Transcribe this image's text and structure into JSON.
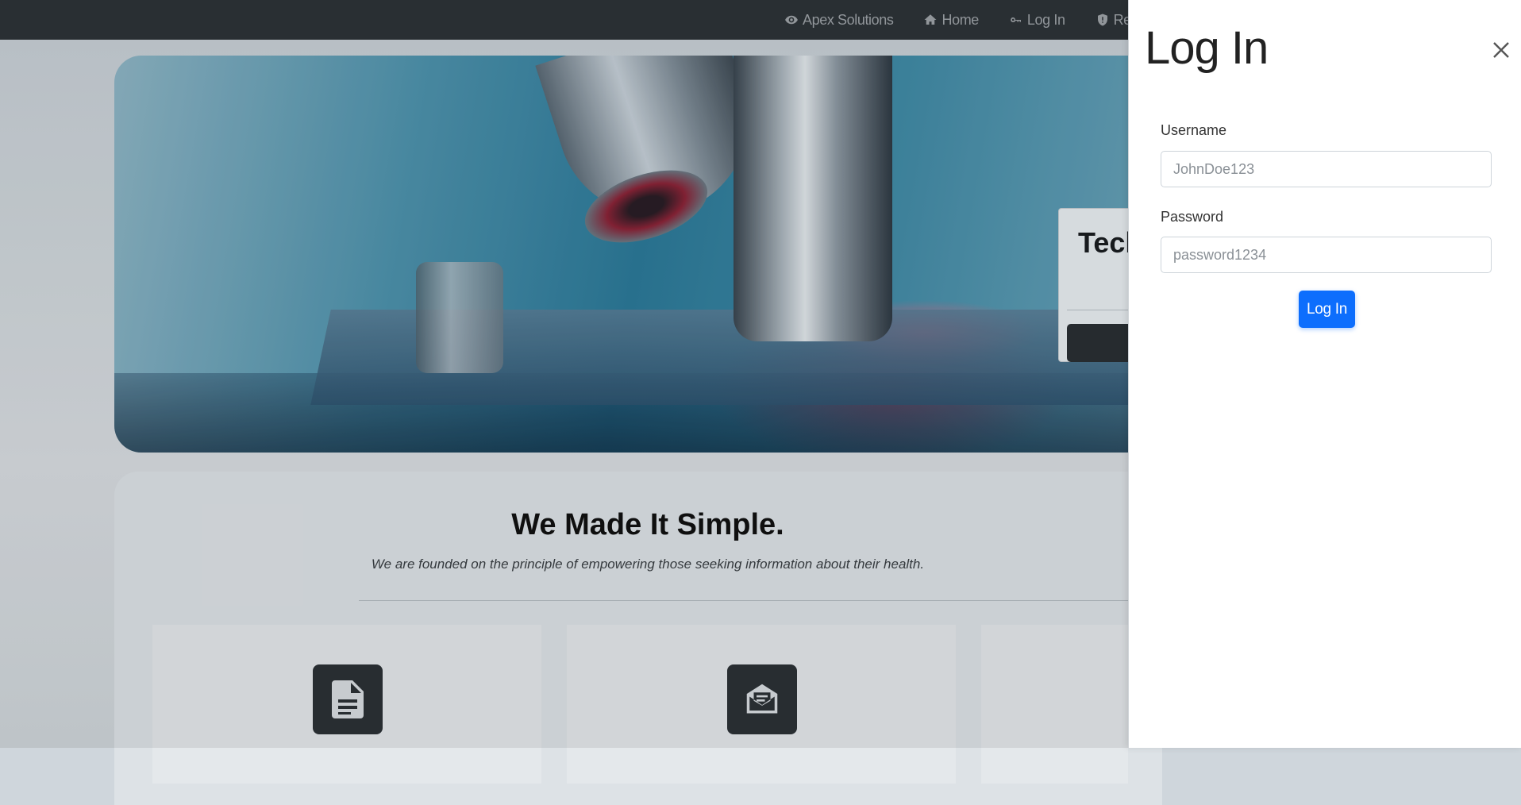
{
  "navbar": {
    "brand": "Apex Solutions",
    "brand_icon": "eye-icon",
    "links": [
      {
        "label": "Home",
        "icon": "home-icon"
      },
      {
        "label": "Log In",
        "icon": "key-icon"
      },
      {
        "label": "Register",
        "icon": "shield-icon"
      }
    ]
  },
  "hero": {
    "card_title": "Tech"
  },
  "section": {
    "title": "We Made It Simple.",
    "subtitle": "We are founded on the principle of empowering those seeking information about their health.",
    "features": [
      {
        "icon": "document-icon"
      },
      {
        "icon": "envelope-open-icon"
      }
    ]
  },
  "login_drawer": {
    "title": "Log In",
    "username_label": "Username",
    "username_placeholder": "JohnDoe123",
    "password_label": "Password",
    "password_placeholder": "password1234",
    "submit_label": "Log In"
  },
  "colors": {
    "navbar_bg": "#2d3338",
    "primary_button": "#0d6efd",
    "feature_icon_bg": "#2c3136"
  }
}
